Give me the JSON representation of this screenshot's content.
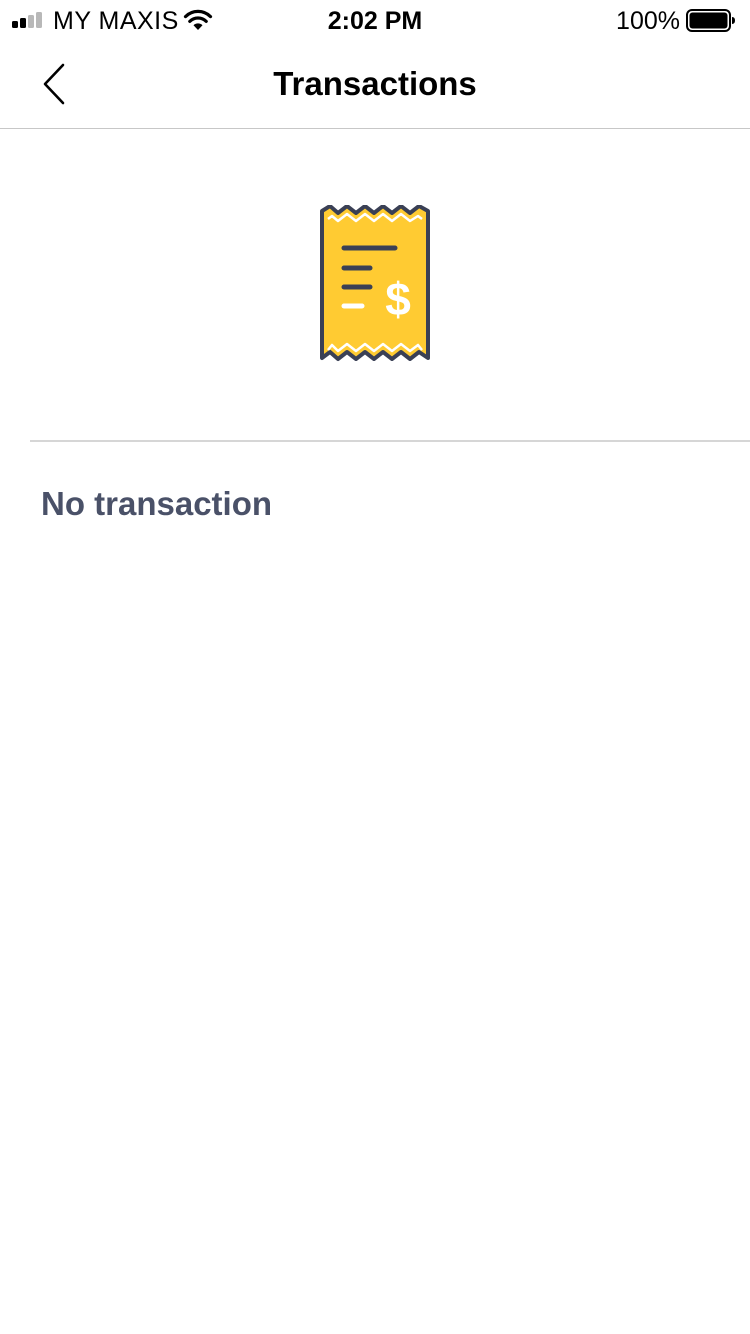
{
  "status_bar": {
    "carrier": "MY MAXIS",
    "time": "2:02 PM",
    "battery_percent": "100%",
    "signal_bars_active": 2,
    "signal_bars_total": 4,
    "wifi_icon": "wifi-icon",
    "battery_icon": "battery-full-icon"
  },
  "nav": {
    "title": "Transactions",
    "back_icon": "chevron-left-icon"
  },
  "empty_state": {
    "illustration": "receipt-dollar-icon",
    "message": "No transaction"
  },
  "colors": {
    "receipt_fill": "#FFCB32",
    "receipt_outline": "#3A4055",
    "message_text": "#4A5168",
    "divider": "#D6D6D6"
  }
}
